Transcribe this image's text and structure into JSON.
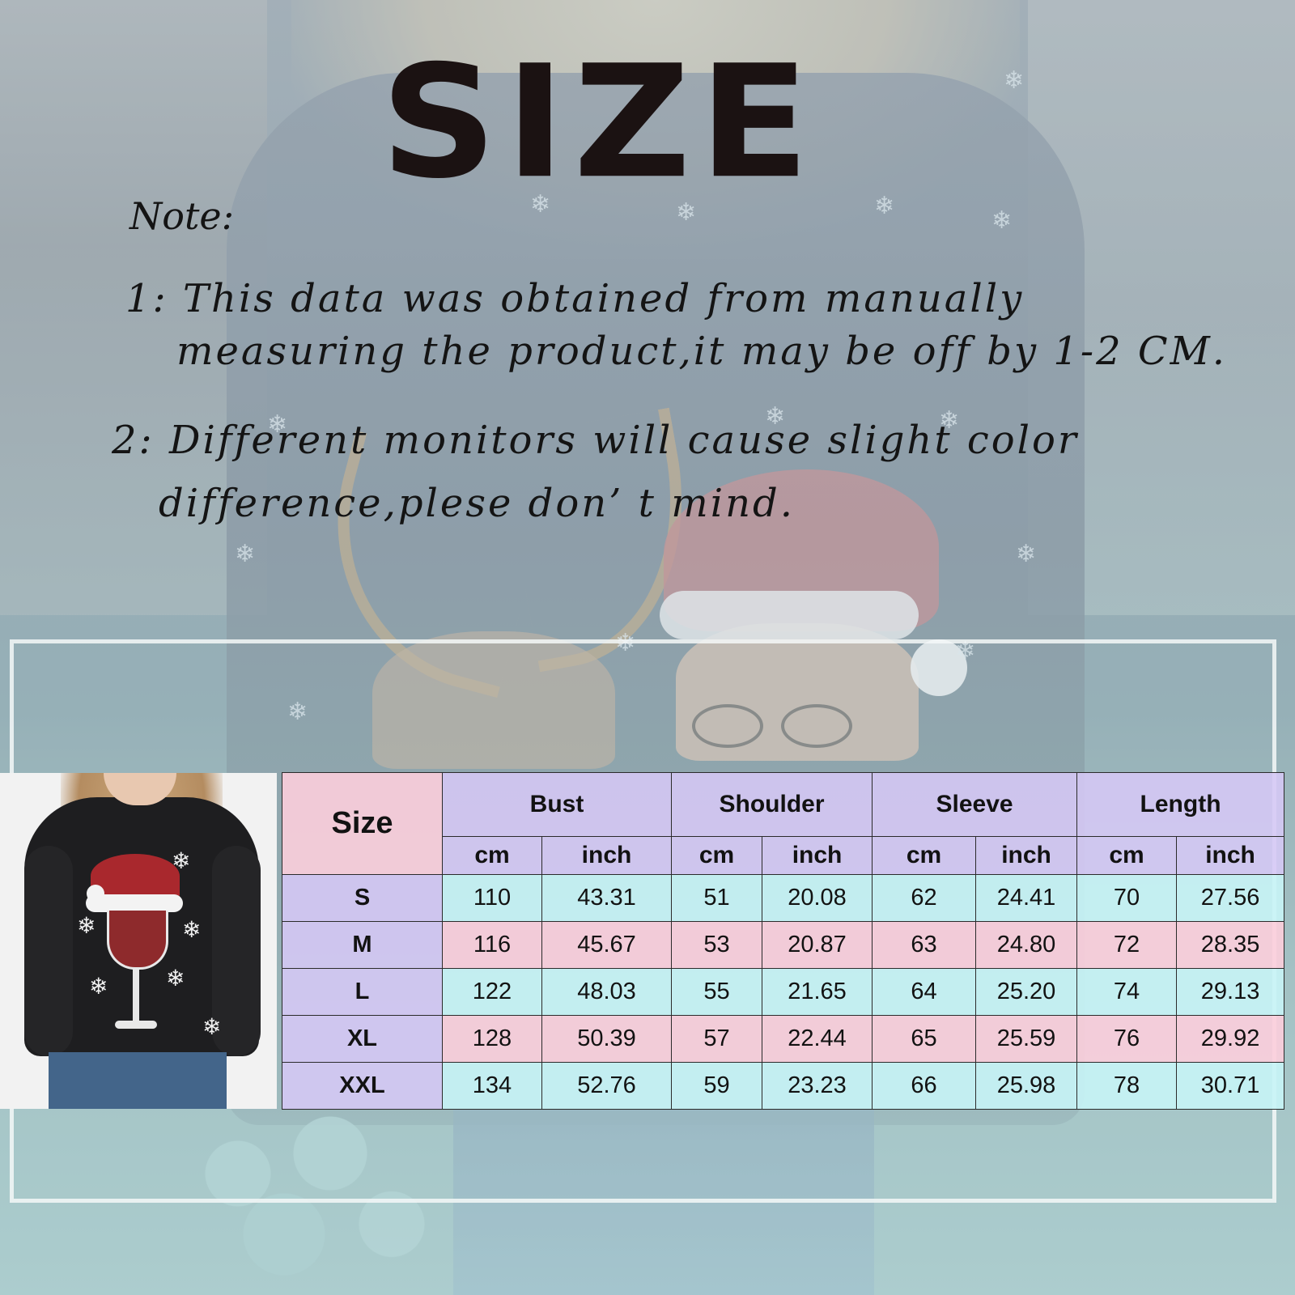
{
  "title": "SIZE",
  "note": {
    "label": "Note:",
    "line1a": "1: This data was obtained from manually",
    "line1b": "measuring the product,it may be off by 1-2 CM.",
    "line2a": "2: Different monitors will cause slight color",
    "line2b": "difference,plese don’ t mind."
  },
  "table": {
    "size_header": "Size",
    "groups": [
      "Bust",
      "Shoulder",
      "Sleeve",
      "Length"
    ],
    "units": [
      "cm",
      "inch",
      "cm",
      "inch",
      "cm",
      "inch",
      "cm",
      "inch"
    ],
    "rows": [
      [
        "S",
        "110",
        "43.31",
        "51",
        "20.08",
        "62",
        "24.41",
        "70",
        "27.56"
      ],
      [
        "M",
        "116",
        "45.67",
        "53",
        "20.87",
        "63",
        "24.80",
        "72",
        "28.35"
      ],
      [
        "L",
        "122",
        "48.03",
        "55",
        "21.65",
        "64",
        "25.20",
        "74",
        "29.13"
      ],
      [
        "XL",
        "128",
        "50.39",
        "57",
        "22.44",
        "65",
        "25.59",
        "76",
        "29.92"
      ],
      [
        "XXL",
        "134",
        "52.76",
        "59",
        "23.23",
        "66",
        "25.98",
        "78",
        "30.71"
      ]
    ]
  },
  "colors": {
    "header_purple": "#d6c8f6",
    "row_cyan": "#c8f4f6",
    "row_pink": "#fccedc",
    "text": "#121212"
  },
  "icons": [
    "snowflake-icon",
    "santa-illustration",
    "wine-glass-print"
  ]
}
